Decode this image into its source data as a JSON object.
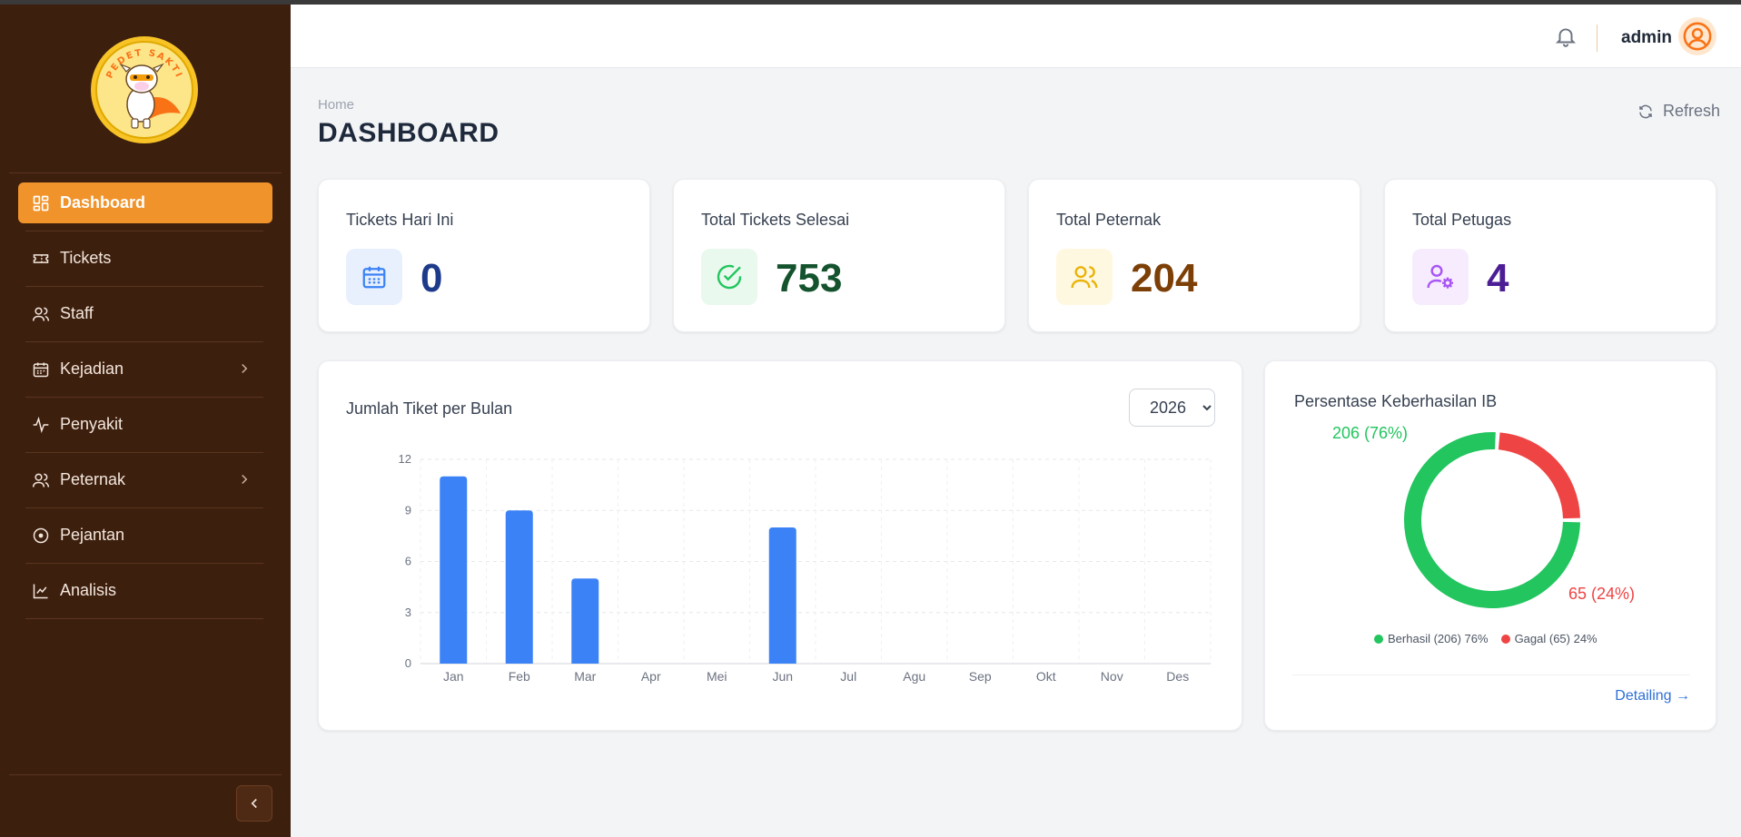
{
  "sidebar": {
    "logo_text": "PEDET SAKTI",
    "items": [
      {
        "label": "Dashboard",
        "icon": "dashboard-icon",
        "active": true,
        "has_submenu": false
      },
      {
        "label": "Tickets",
        "icon": "ticket-icon",
        "active": false,
        "has_submenu": false
      },
      {
        "label": "Staff",
        "icon": "users-icon",
        "active": false,
        "has_submenu": false
      },
      {
        "label": "Kejadian",
        "icon": "calendar-icon",
        "active": false,
        "has_submenu": true
      },
      {
        "label": "Penyakit",
        "icon": "activity-icon",
        "active": false,
        "has_submenu": false
      },
      {
        "label": "Peternak",
        "icon": "users-icon",
        "active": false,
        "has_submenu": true
      },
      {
        "label": "Pejantan",
        "icon": "target-icon",
        "active": false,
        "has_submenu": false
      },
      {
        "label": "Analisis",
        "icon": "line-chart-icon",
        "active": false,
        "has_submenu": false
      }
    ]
  },
  "header": {
    "username": "admin"
  },
  "page": {
    "breadcrumb": "Home",
    "title": "DASHBOARD",
    "refresh_label": "Refresh"
  },
  "stats": [
    {
      "label": "Tickets Hari Ini",
      "value": "0",
      "icon": "calendar-icon",
      "color": "#1e3a8a",
      "bg": "#e8f0fe"
    },
    {
      "label": "Total Tickets Selesai",
      "value": "753",
      "icon": "check-circle-icon",
      "color": "#14532d",
      "bg": "#e9f9ee"
    },
    {
      "label": "Total Peternak",
      "value": "204",
      "icon": "users-icon",
      "color": "#7c3f06",
      "bg": "#fff8e1"
    },
    {
      "label": "Total Petugas",
      "value": "4",
      "icon": "user-cog-icon",
      "color": "#4c1d95",
      "bg": "#f7ecfd"
    }
  ],
  "bar_chart": {
    "title": "Jumlah Tiket per Bulan",
    "year_selected": "2026",
    "year_options": [
      "2026"
    ]
  },
  "donut_chart": {
    "title": "Persentase Keberhasilan IB",
    "detail_link": "Detailing →",
    "labels": [
      "206 (76%)",
      "65 (24%)"
    ],
    "legend": [
      "Berhasil (206) 76%",
      "Gagal (65) 24%"
    ]
  },
  "chart_data": [
    {
      "type": "bar",
      "title": "Jumlah Tiket per Bulan",
      "categories": [
        "Jan",
        "Feb",
        "Mar",
        "Apr",
        "Mei",
        "Jun",
        "Jul",
        "Agu",
        "Sep",
        "Okt",
        "Nov",
        "Des"
      ],
      "values": [
        11,
        9,
        5,
        0,
        0,
        8,
        0,
        0,
        0,
        0,
        0,
        0
      ],
      "ylim": [
        0,
        12
      ],
      "yticks": [
        0,
        3,
        6,
        9,
        12
      ],
      "grid": true,
      "color": "#3b82f6"
    },
    {
      "type": "pie",
      "title": "Persentase Keberhasilan IB",
      "categories": [
        "Berhasil",
        "Gagal"
      ],
      "values": [
        206,
        65
      ],
      "percents": [
        76,
        24
      ],
      "colors": [
        "#22c55e",
        "#ef4444"
      ],
      "legend": "bottom"
    }
  ]
}
